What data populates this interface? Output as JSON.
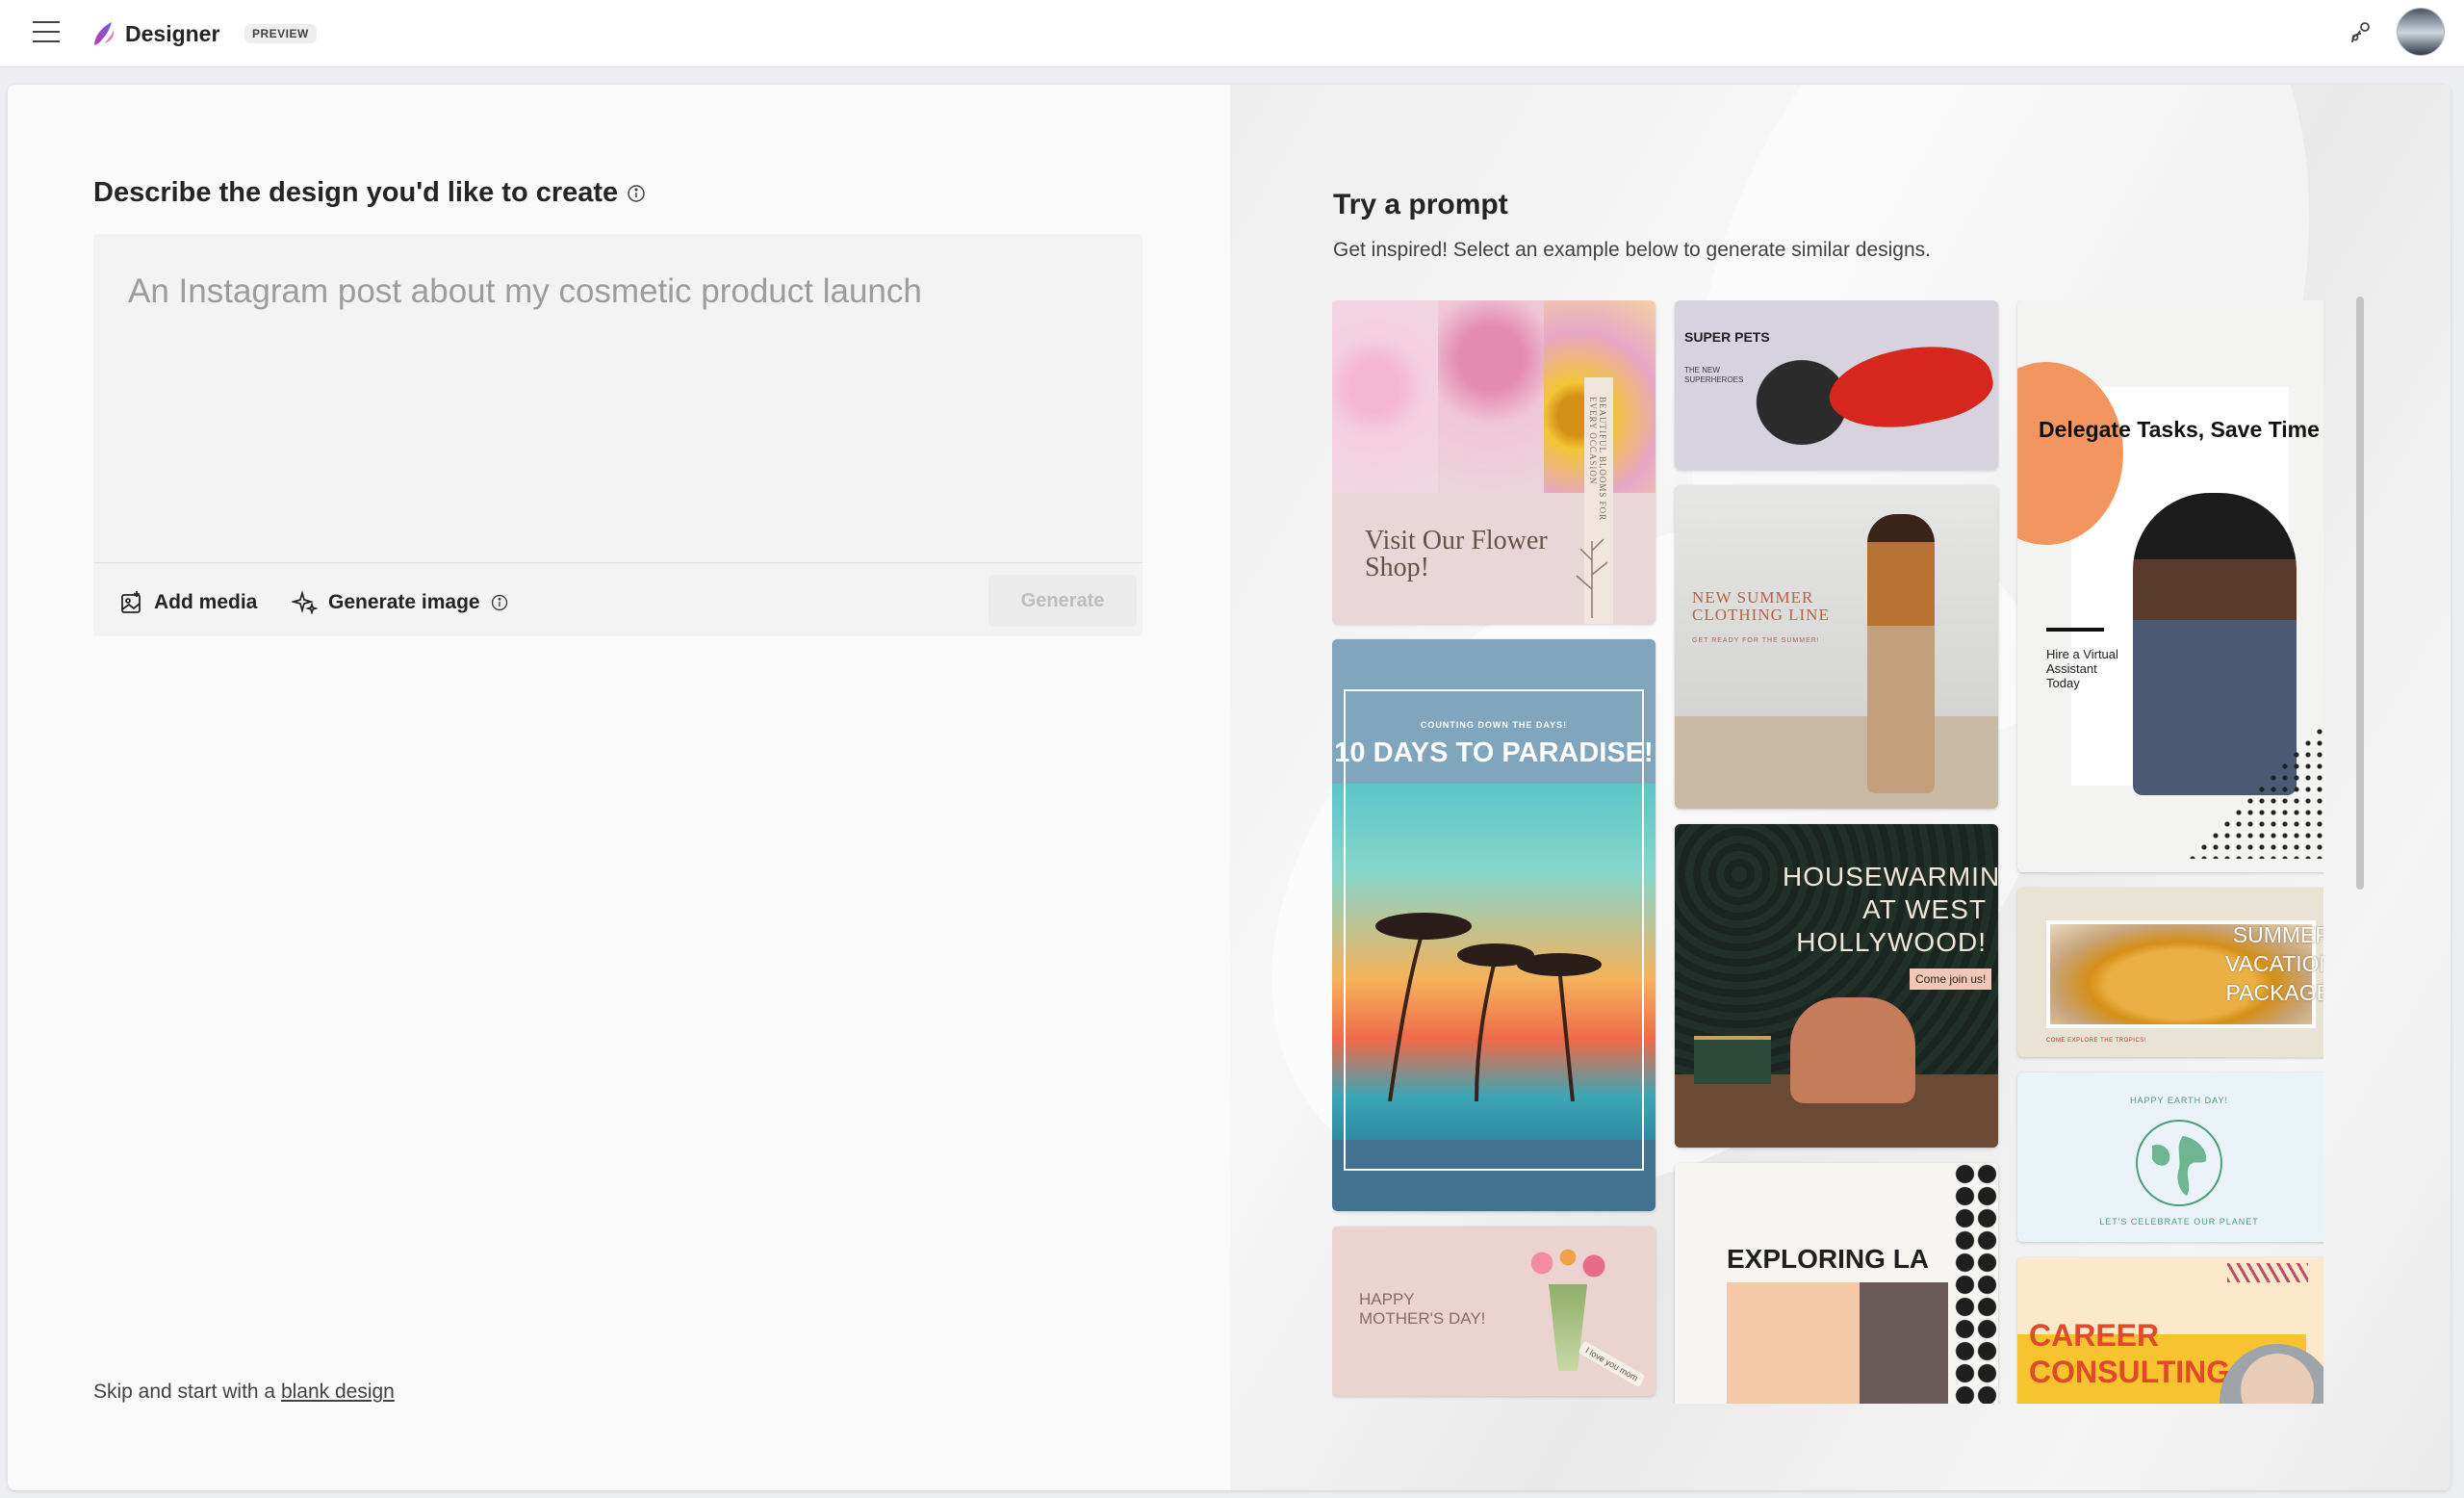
{
  "app": {
    "brand": "Designer",
    "badge": "PREVIEW"
  },
  "left": {
    "heading": "Describe the design you'd like to create",
    "prompt_placeholder": "An Instagram post about my cosmetic product launch",
    "add_media": "Add media",
    "generate_image": "Generate image",
    "generate": "Generate",
    "skip_prefix": "Skip and start with a ",
    "skip_link": "blank design"
  },
  "right": {
    "title": "Try a prompt",
    "subtitle": "Get inspired! Select an example below to generate similar designs."
  },
  "tiles": {
    "flower": {
      "title": "Visit Our Flower Shop!",
      "side": "BEAUTIFUL BLOOMS FOR EVERY OCCASION"
    },
    "pets": {
      "title": "SUPER PETS",
      "sub": "THE NEW SUPERHEROES"
    },
    "delegate": {
      "title": "Delegate Tasks, Save Time",
      "sub": "Hire a Virtual Assistant Today"
    },
    "paradise": {
      "kicker": "COUNTING DOWN THE DAYS!",
      "title": "10 DAYS TO PARADISE!"
    },
    "summer_line": {
      "title": "NEW SUMMER CLOTHING LINE",
      "sub": "GET READY FOR THE SUMMER!"
    },
    "vacation": {
      "title": "SUMMER VACATION PACKAGE",
      "sub": "COME EXPLORE THE TROPICS!"
    },
    "housewarming": {
      "title": "HOUSEWARMING AT WEST HOLLYWOOD!",
      "tag": "Come join us!"
    },
    "earth": {
      "title": "HAPPY EARTH DAY!",
      "sub": "LET'S CELEBRATE OUR PLANET"
    },
    "mothers": {
      "title": "HAPPY MOTHER'S DAY!",
      "tag": "I love you mom"
    },
    "la": {
      "title": "EXPLORING LA"
    },
    "career": {
      "title": "CAREER CONSULTING"
    }
  },
  "colors": {
    "accent_purple": "#7a45d0",
    "paradise_blue": "#42728f",
    "career_red": "#e0492a",
    "delegate_orange": "#f3955f",
    "earth_green": "#4f9c77"
  }
}
